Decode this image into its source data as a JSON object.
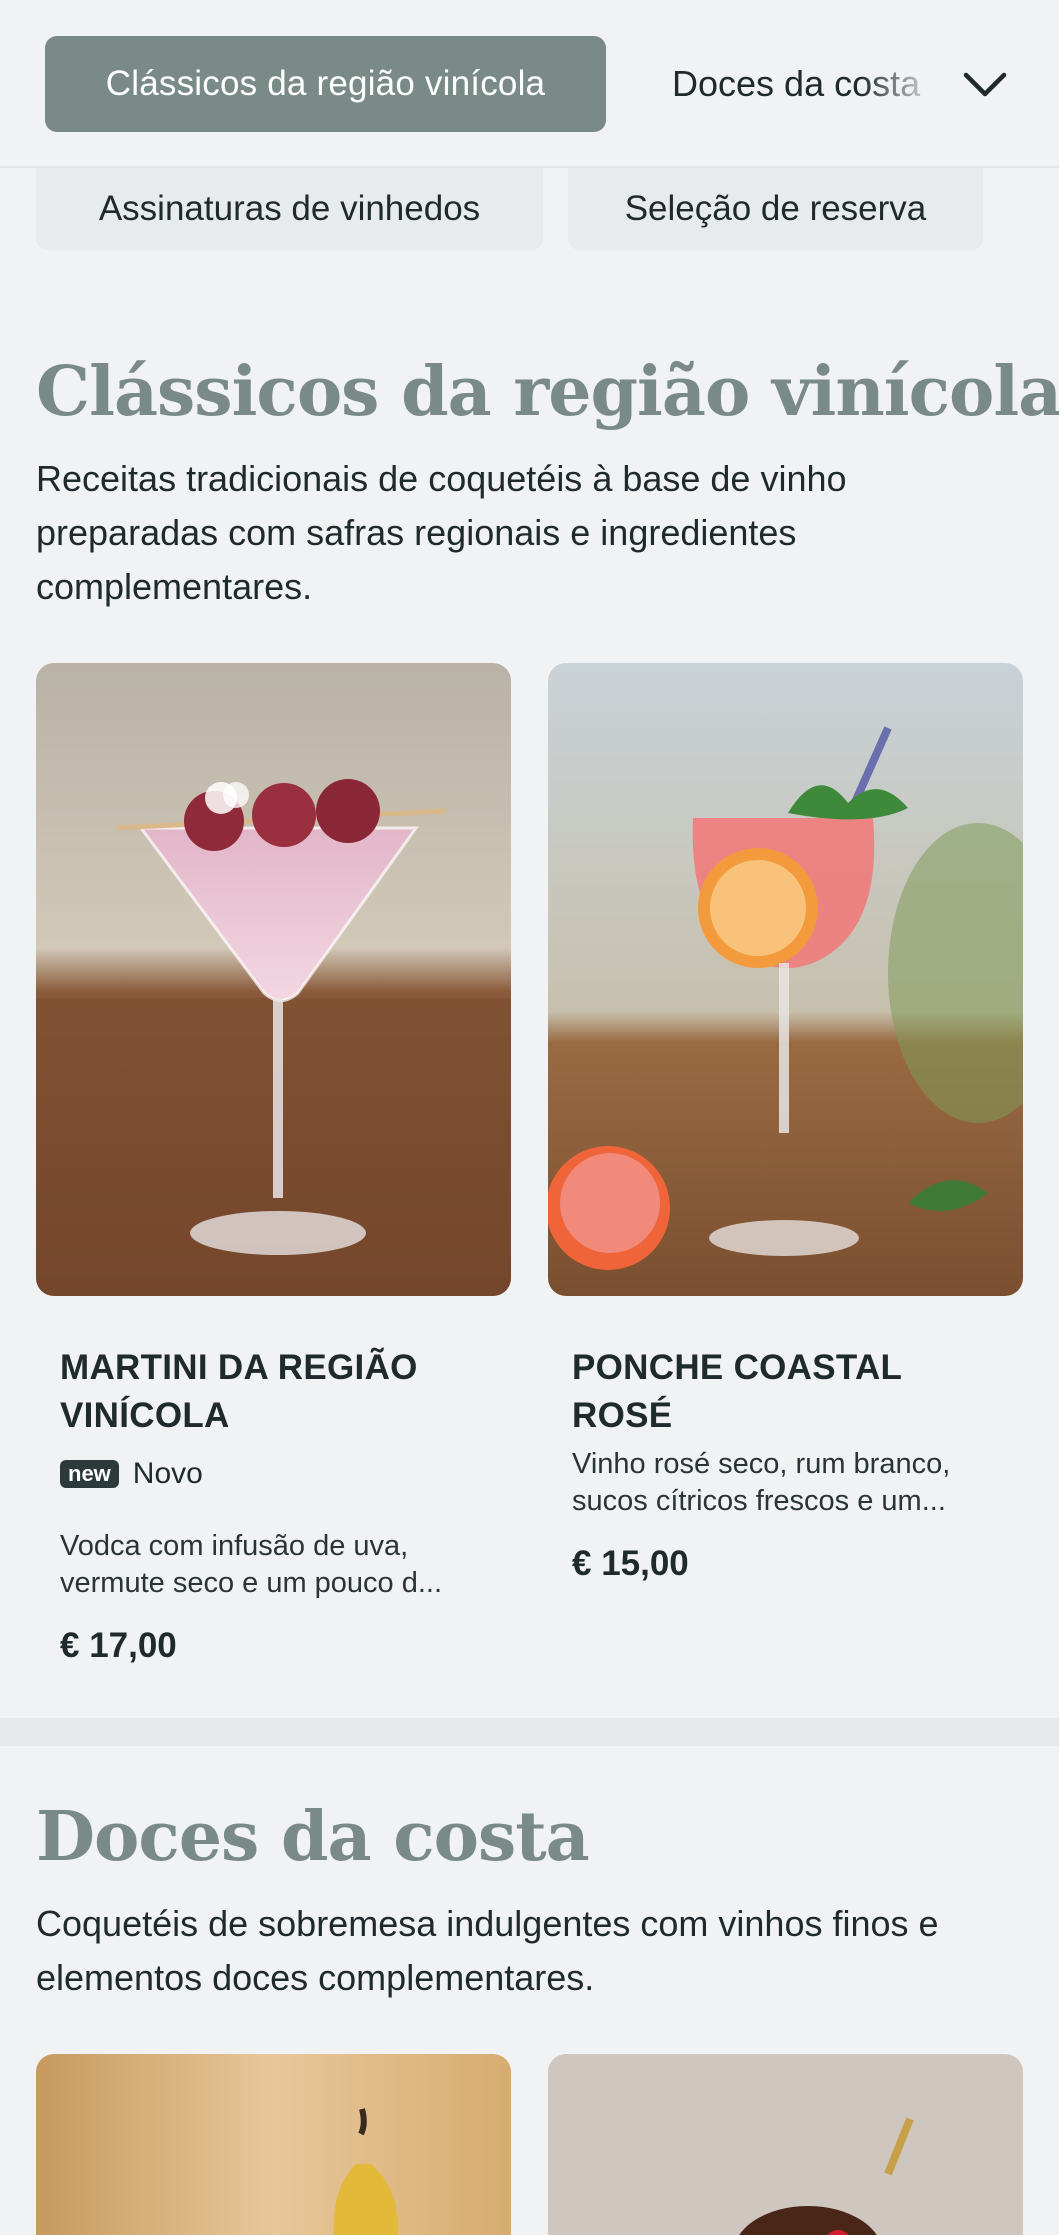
{
  "category_nav": {
    "active_label": "Clássicos da região vinícola",
    "next_label": "Doces da costa",
    "secondary": [
      "Assinaturas de vinhedos",
      "Seleção de reserva"
    ],
    "expand_icon": "chevron-down-icon"
  },
  "sections": [
    {
      "title": "Clássicos da região vinícola",
      "description": "Receitas tradicionais de coquetéis à base de vinho preparadas com safras regionais e ingredientes complementares.",
      "items": [
        {
          "name": "MARTINI DA REGIÃO VINÍCOLA",
          "badge": "new",
          "badge_label": "Novo",
          "description": "Vodca com infusão de uva, vermute seco e um pouco d...",
          "price": "€ 17,00"
        },
        {
          "name": "PONCHE COASTAL ROSÉ",
          "description": "Vinho rosé seco, rum branco, sucos cítricos frescos e um...",
          "price": "€ 15,00"
        }
      ]
    },
    {
      "title": "Doces da costa",
      "description": "Coquetéis de sobremesa indulgentes com vinhos finos e elementos doces complementares."
    }
  ],
  "colors": {
    "accent": "#7a8b87",
    "background": "#f0f2f4",
    "text": "#1f2a2c"
  }
}
